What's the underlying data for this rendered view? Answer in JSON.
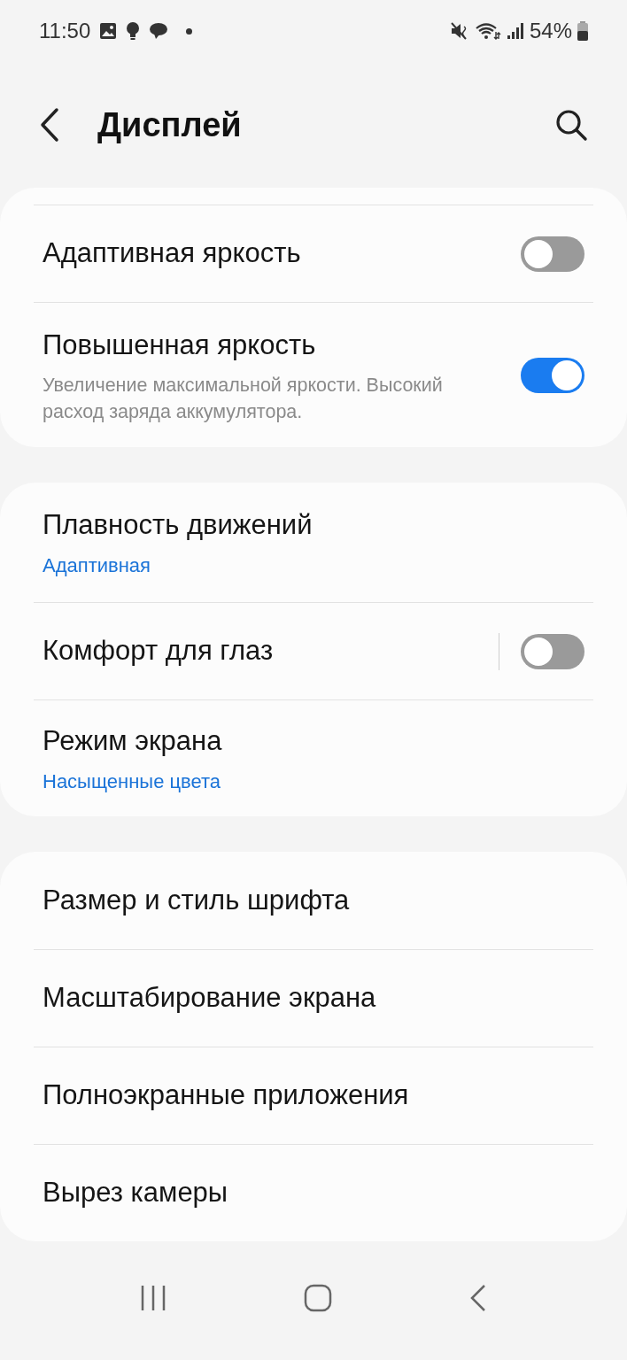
{
  "status_bar": {
    "time": "11:50",
    "battery": "54%"
  },
  "header": {
    "title": "Дисплей"
  },
  "groups": [
    {
      "scrolled": true,
      "items": [
        {
          "kind": "toggle",
          "title": "Адаптивная яркость",
          "on": false,
          "split": false
        },
        {
          "kind": "toggle",
          "title": "Повышенная яркость",
          "subtitle": "Увеличение максимальной яркости. Высокий расход заряда аккумулятора.",
          "on": true,
          "split": false
        }
      ]
    },
    {
      "scrolled": false,
      "items": [
        {
          "kind": "link",
          "title": "Плавность движений",
          "value": "Адаптивная"
        },
        {
          "kind": "toggle",
          "title": "Комфорт для глаз",
          "on": false,
          "split": true
        },
        {
          "kind": "link",
          "title": "Режим экрана",
          "value": "Насыщенные цвета"
        }
      ]
    },
    {
      "scrolled": false,
      "items": [
        {
          "kind": "link",
          "title": "Размер и стиль шрифта"
        },
        {
          "kind": "link",
          "title": "Масштабирование экрана"
        },
        {
          "kind": "link",
          "title": "Полноэкранные приложения"
        },
        {
          "kind": "link",
          "title": "Вырез камеры"
        }
      ]
    }
  ]
}
